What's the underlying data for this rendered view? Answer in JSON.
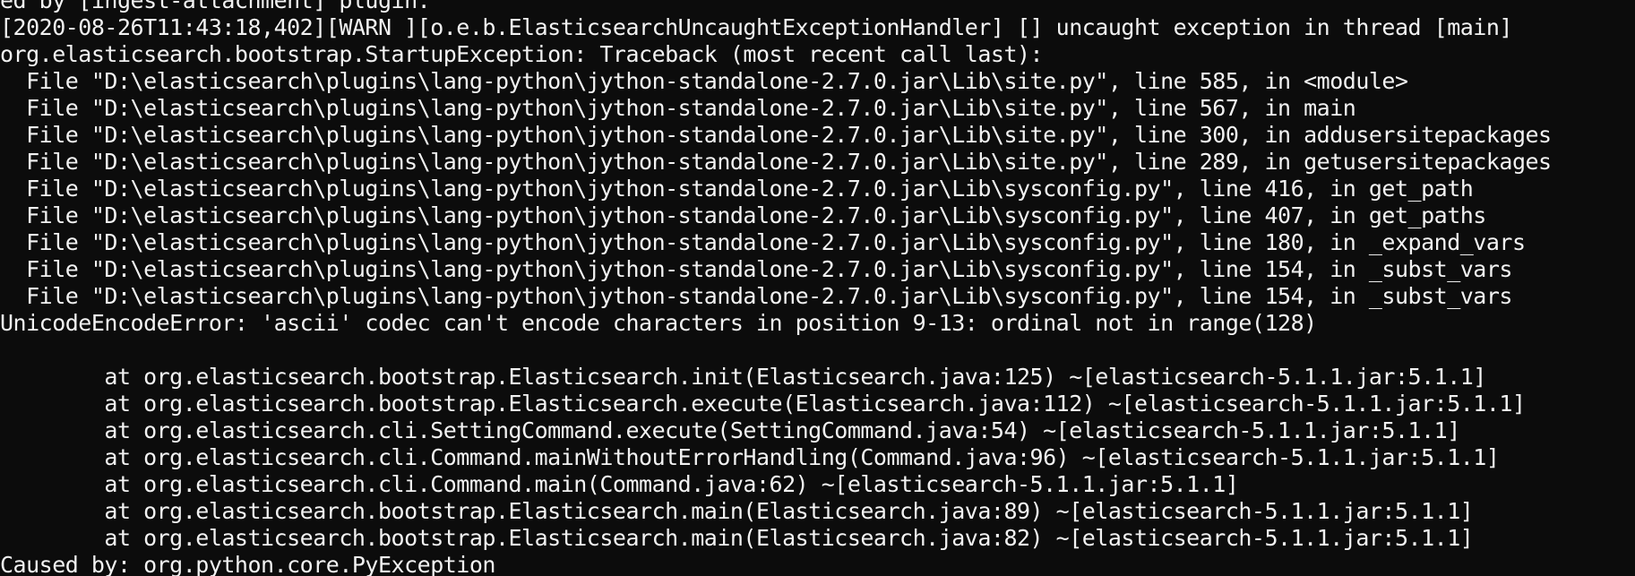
{
  "console": {
    "lines": [
      "ed by [ingest-attachment] plugin.",
      "[2020-08-26T11:43:18,402][WARN ][o.e.b.ElasticsearchUncaughtExceptionHandler] [] uncaught exception in thread [main]",
      "org.elasticsearch.bootstrap.StartupException: Traceback (most recent call last):",
      "  File \"D:\\elasticsearch\\plugins\\lang-python\\jython-standalone-2.7.0.jar\\Lib\\site.py\", line 585, in <module>",
      "  File \"D:\\elasticsearch\\plugins\\lang-python\\jython-standalone-2.7.0.jar\\Lib\\site.py\", line 567, in main",
      "  File \"D:\\elasticsearch\\plugins\\lang-python\\jython-standalone-2.7.0.jar\\Lib\\site.py\", line 300, in addusersitepackages",
      "  File \"D:\\elasticsearch\\plugins\\lang-python\\jython-standalone-2.7.0.jar\\Lib\\site.py\", line 289, in getusersitepackages",
      "  File \"D:\\elasticsearch\\plugins\\lang-python\\jython-standalone-2.7.0.jar\\Lib\\sysconfig.py\", line 416, in get_path",
      "  File \"D:\\elasticsearch\\plugins\\lang-python\\jython-standalone-2.7.0.jar\\Lib\\sysconfig.py\", line 407, in get_paths",
      "  File \"D:\\elasticsearch\\plugins\\lang-python\\jython-standalone-2.7.0.jar\\Lib\\sysconfig.py\", line 180, in _expand_vars",
      "  File \"D:\\elasticsearch\\plugins\\lang-python\\jython-standalone-2.7.0.jar\\Lib\\sysconfig.py\", line 154, in _subst_vars",
      "  File \"D:\\elasticsearch\\plugins\\lang-python\\jython-standalone-2.7.0.jar\\Lib\\sysconfig.py\", line 154, in _subst_vars",
      "UnicodeEncodeError: 'ascii' codec can't encode characters in position 9-13: ordinal not in range(128)",
      "",
      "        at org.elasticsearch.bootstrap.Elasticsearch.init(Elasticsearch.java:125) ~[elasticsearch-5.1.1.jar:5.1.1]",
      "        at org.elasticsearch.bootstrap.Elasticsearch.execute(Elasticsearch.java:112) ~[elasticsearch-5.1.1.jar:5.1.1]",
      "        at org.elasticsearch.cli.SettingCommand.execute(SettingCommand.java:54) ~[elasticsearch-5.1.1.jar:5.1.1]",
      "        at org.elasticsearch.cli.Command.mainWithoutErrorHandling(Command.java:96) ~[elasticsearch-5.1.1.jar:5.1.1]",
      "        at org.elasticsearch.cli.Command.main(Command.java:62) ~[elasticsearch-5.1.1.jar:5.1.1]",
      "        at org.elasticsearch.bootstrap.Elasticsearch.main(Elasticsearch.java:89) ~[elasticsearch-5.1.1.jar:5.1.1]",
      "        at org.elasticsearch.bootstrap.Elasticsearch.main(Elasticsearch.java:82) ~[elasticsearch-5.1.1.jar:5.1.1]",
      "Caused by: org.python.core.PyException"
    ]
  },
  "colors": {
    "background": "#0c0c0c",
    "text": "#f2f2f2"
  }
}
